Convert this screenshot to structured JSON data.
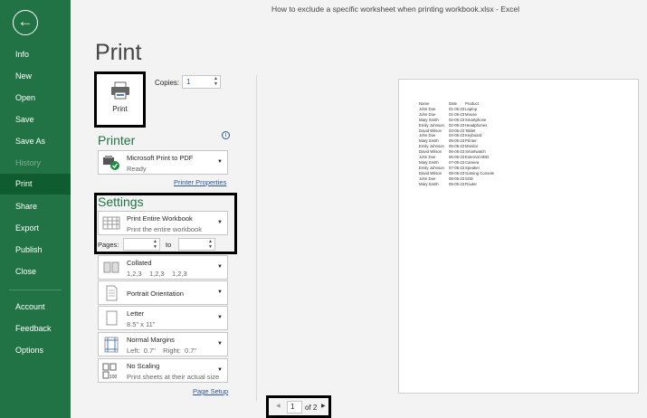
{
  "window": {
    "title": "How to exclude a specific worksheet when printing workbook.xlsx  -  Excel"
  },
  "sidebar": {
    "back": "←",
    "items": [
      {
        "label": "Info"
      },
      {
        "label": "New"
      },
      {
        "label": "Open"
      },
      {
        "label": "Save"
      },
      {
        "label": "Save As"
      },
      {
        "label": "History",
        "disabled": true
      },
      {
        "label": "Print",
        "active": true
      },
      {
        "label": "Share"
      },
      {
        "label": "Export"
      },
      {
        "label": "Publish"
      },
      {
        "label": "Close"
      }
    ],
    "bottom": [
      {
        "label": "Account"
      },
      {
        "label": "Feedback"
      },
      {
        "label": "Options"
      }
    ]
  },
  "page_title": "Print",
  "print_button": "Print",
  "copies": {
    "label": "Copies:",
    "value": "1"
  },
  "printer": {
    "heading": "Printer",
    "name": "Microsoft Print to PDF",
    "status": "Ready",
    "properties_link": "Printer Properties",
    "info": "i"
  },
  "settings": {
    "heading": "Settings",
    "what": {
      "l1": "Print Entire Workbook",
      "l2": "Print the entire workbook"
    },
    "pages_label": "Pages:",
    "to_label": "to",
    "collated": {
      "l1": "Collated",
      "l2": "1,2,3    1,2,3    1,2,3"
    },
    "orientation": {
      "l1": "Portrait Orientation"
    },
    "paper": {
      "l1": "Letter",
      "l2": "8.5\" x 11\""
    },
    "margins": {
      "l1": "Normal Margins",
      "l2": "Left:  0.7\"    Right:  0.7\""
    },
    "scaling": {
      "l1": "No Scaling",
      "l2": "Print sheets at their actual size"
    },
    "page_setup_link": "Page Setup"
  },
  "preview": {
    "headers": [
      "Name",
      "Date",
      "Product"
    ],
    "rows": [
      [
        "John Doe",
        "01-05-23",
        "Laptop"
      ],
      [
        "John Doe",
        "01-05-23",
        "Mouse"
      ],
      [
        "Mary Smith",
        "02-05-23",
        "Smartphone"
      ],
      [
        "Emily Johnson",
        "02-05-23",
        "Headphones"
      ],
      [
        "David Wilson",
        "03-05-23",
        "Tablet"
      ],
      [
        "John Doe",
        "04-05-23",
        "Keyboard"
      ],
      [
        "Mary Smith",
        "05-05-23",
        "Printer"
      ],
      [
        "Emily Johnson",
        "05-05-23",
        "Monitor"
      ],
      [
        "David Wilson",
        "06-05-23",
        "Smartwatch"
      ],
      [
        "John Doe",
        "06-05-23",
        "External HDD"
      ],
      [
        "Mary Smith",
        "07-05-23",
        "Camera"
      ],
      [
        "Emily Johnson",
        "07-05-23",
        "Speaker"
      ],
      [
        "David Wilson",
        "08-05-23",
        "Gaming Console"
      ],
      [
        "John Doe",
        "08-05-23",
        "SSD"
      ],
      [
        "Mary Smith",
        "09-05-23",
        "Router"
      ]
    ]
  },
  "pager": {
    "current": "1",
    "total": "of 2"
  }
}
